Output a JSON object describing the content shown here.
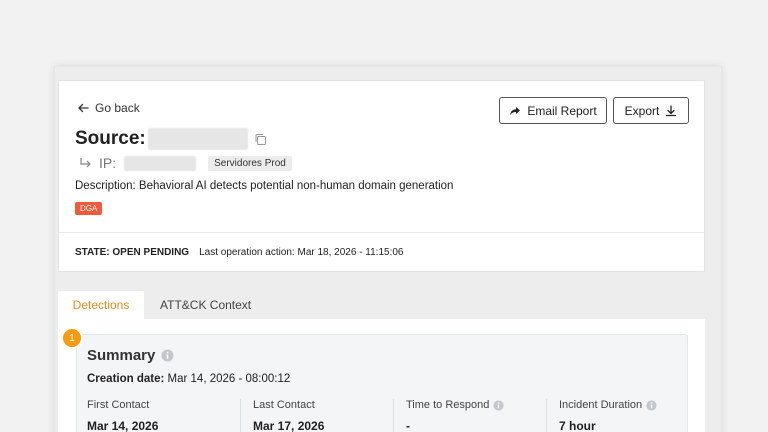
{
  "header": {
    "go_back": "Go back",
    "email_report": "Email Report",
    "export": "Export",
    "source_label": "Source:",
    "ip_label": "IP:",
    "ip_tag": "Servidores Prod",
    "description": "Description: Behavioral AI detects potential non-human domain generation",
    "tag": "DGA",
    "state": "STATE: OPEN PENDING",
    "last_action": "Last operation action: Mar 18, 2026 - 11:15:06"
  },
  "tabs": [
    {
      "label": "Detections",
      "active": true
    },
    {
      "label": "ATT&CK Context",
      "active": false
    }
  ],
  "summary": {
    "badge": "1",
    "title": "Summary",
    "creation_label": "Creation date:",
    "creation_value": "Mar 14, 2026 - 08:00:12",
    "metrics": [
      {
        "label": "First Contact",
        "value": "Mar 14, 2026"
      },
      {
        "label": "Last Contact",
        "value": "Mar 17, 2026"
      },
      {
        "label": "Time to Respond",
        "value": "-"
      },
      {
        "label": "Incident Duration",
        "value": "7 hour"
      }
    ]
  },
  "colors": {
    "accent": "#e58b1a",
    "badge": "#f59b12",
    "tag_dga": "#f05a3a"
  },
  "icons": [
    "arrow-left-icon",
    "share-icon",
    "download-icon",
    "copy-icon",
    "return-arrow-icon",
    "info-icon"
  ]
}
